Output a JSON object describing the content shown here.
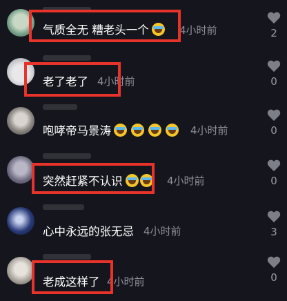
{
  "comments": [
    {
      "text": "气质全无 糟老头一个",
      "emoji_count": 1,
      "time": "4小时前",
      "likes": "2"
    },
    {
      "text": "老了老了",
      "emoji_count": 0,
      "time": "4小时前",
      "likes": "0"
    },
    {
      "text": "咆哮帝马景涛",
      "emoji_count": 4,
      "time": "4小时前",
      "likes": "0"
    },
    {
      "text": "突然赶紧不认识",
      "emoji_count": 2,
      "time": "4小时前",
      "likes": "0"
    },
    {
      "text": "心中永远的张无忌",
      "emoji_count": 0,
      "time": "4小时前",
      "likes": "3"
    },
    {
      "text": "老成这样了",
      "emoji_count": 0,
      "time": "4小时前",
      "likes": "0"
    }
  ],
  "icons": {
    "like": "heart-icon",
    "emoji": "laugh-cry-emoji-icon"
  },
  "colors": {
    "highlight_box": "#e8332b",
    "background": "#15161d",
    "time_text": "#8d8f9a"
  }
}
